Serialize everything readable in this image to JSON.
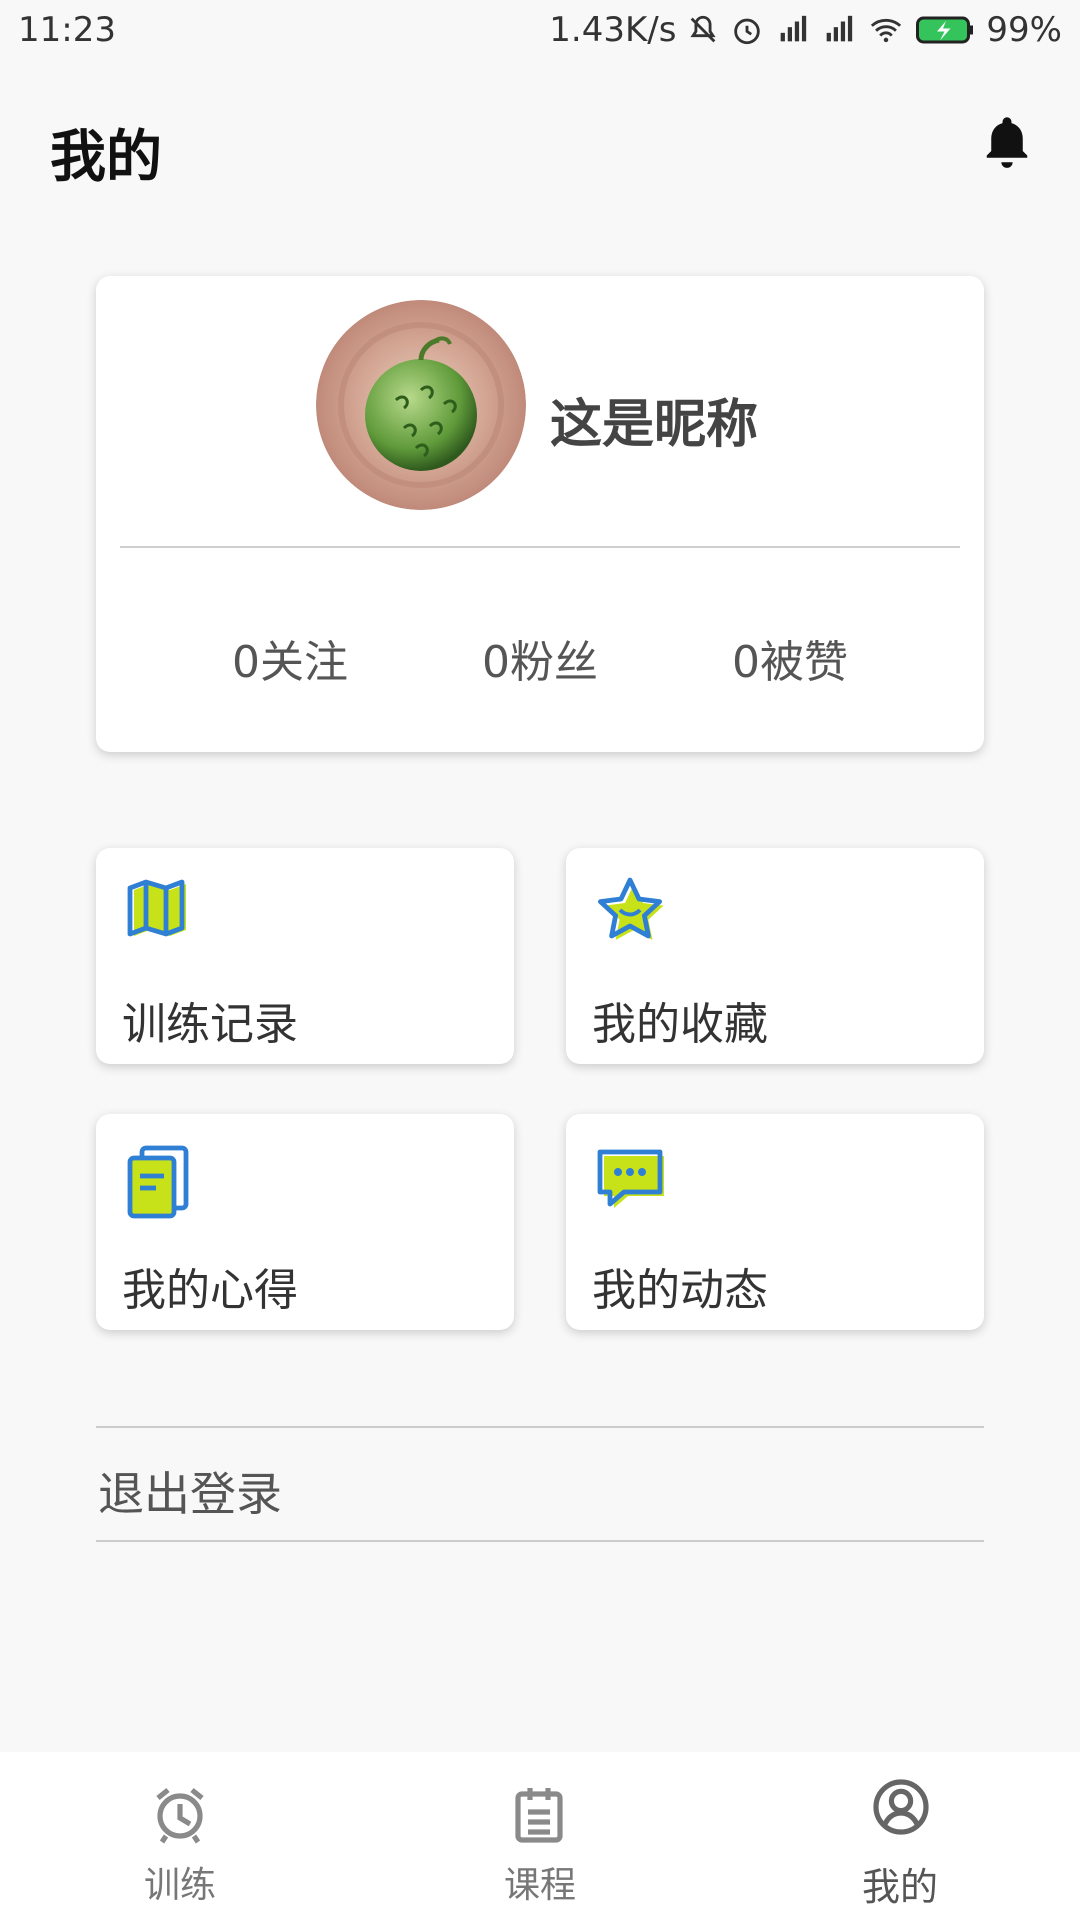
{
  "status_bar": {
    "time": "11:23",
    "net_speed": "1.43K/s",
    "battery": "99%",
    "icons": [
      "mute-icon",
      "alarm-icon",
      "hd-signal-icon",
      "signal-icon",
      "wifi-icon",
      "battery-charging-icon"
    ]
  },
  "header": {
    "title": "我的",
    "bell_icon": "bell-icon"
  },
  "profile": {
    "nickname": "这是昵称",
    "stats": [
      {
        "label": "0关注"
      },
      {
        "label": "0粉丝"
      },
      {
        "label": "0被赞"
      }
    ]
  },
  "tiles": [
    {
      "label": "训练记录",
      "icon": "map-icon"
    },
    {
      "label": "我的收藏",
      "icon": "star-icon"
    },
    {
      "label": "我的心得",
      "icon": "notebook-icon"
    },
    {
      "label": "我的动态",
      "icon": "chat-icon"
    }
  ],
  "logout": {
    "label": "退出登录"
  },
  "bottom_nav": {
    "items": [
      {
        "label": "训练",
        "icon": "alarm-clock-icon"
      },
      {
        "label": "课程",
        "icon": "calendar-icon"
      },
      {
        "label": "我的",
        "icon": "user-circle-icon"
      }
    ],
    "active_index": 2
  },
  "colors": {
    "accent_blue": "#2f7fd4",
    "accent_lime": "#c8e21a",
    "background": "#f8f8f8"
  }
}
